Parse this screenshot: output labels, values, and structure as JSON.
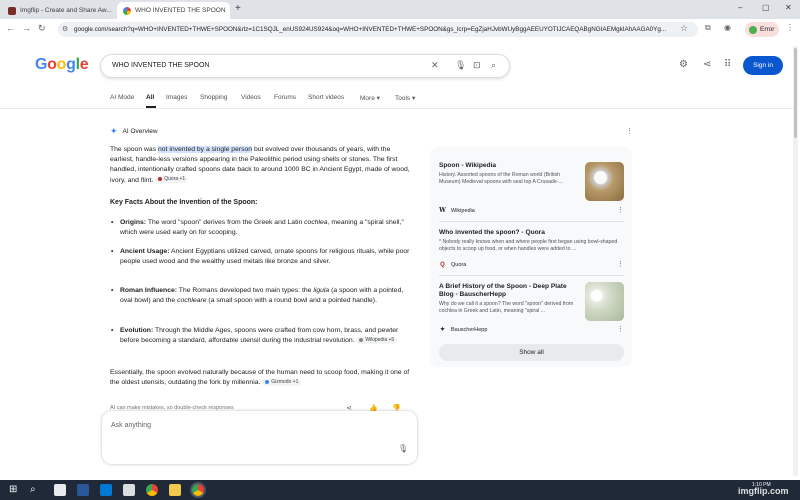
{
  "browser": {
    "tabs": [
      {
        "title": "Imgflip - Create and Share Aw...",
        "active": false
      },
      {
        "title": "WHO INVENTED THE SPOON",
        "active": true
      }
    ],
    "new_tab": "+",
    "url": "google.com/search?q=WHO+INVENTED+THWE+SPOON&rlz=1C1SQJL_enUS924US924&oq=WHO+INVENTED+THWE+SPOON&gs_lcrp=EgZjaHJvbWUyBggAEEUYOTIJCAEQABgNGIAEMgkIAhAAGA0Yg...",
    "error_button": "Error",
    "window_controls": [
      "–",
      "▢",
      "✕"
    ]
  },
  "google": {
    "logo_letters": [
      {
        "ch": "G",
        "color": "#4285f4"
      },
      {
        "ch": "o",
        "color": "#ea4335"
      },
      {
        "ch": "o",
        "color": "#fbbc05"
      },
      {
        "ch": "g",
        "color": "#4285f4"
      },
      {
        "ch": "l",
        "color": "#34a853"
      },
      {
        "ch": "e",
        "color": "#ea4335"
      }
    ],
    "query": "WHO INVENTED THE SPOON",
    "sign_in": "Sign in",
    "tabs": [
      "AI Mode",
      "All",
      "Images",
      "Shopping",
      "Videos",
      "Forums",
      "Short videos",
      "More ▾",
      "Tools ▾"
    ],
    "selected_tab": "All"
  },
  "ai_overview": {
    "heading": "AI Overview",
    "intro_pre": "The spoon was ",
    "intro_highlight": "not invented by a single person",
    "intro_post": " but evolved over thousands of years, with the earliest, handle-less versions appearing in the Paleolithic period using shells or stones. The first handled, intentionally crafted spoons date back to around 1000 BC in Ancient Egypt, made of wood, ivory, and flint.",
    "intro_chip": "Quora +1",
    "facts_heading": "Key Facts About the Invention of the Spoon:",
    "facts": [
      {
        "label": "Origins:",
        "text": " The word \"spoon\" derives from the Greek and Latin ",
        "em": "cochlea",
        "text2": ", meaning a \"spiral shell,\" which were used early on for scooping."
      },
      {
        "label": "Ancient Usage:",
        "text": " Ancient Egyptians utilized carved, ornate spoons for religious rituals, while poor people used wood and the wealthy used metals like bronze and silver.",
        "em": "",
        "text2": ""
      },
      {
        "label": "Roman Influence:",
        "text": " The Romans developed two main types: the ",
        "em": "ligula",
        "text2": " (a spoon with a pointed, oval bowl) and the ",
        "em2": "cochleare",
        "text3": " (a small spoon with a round bowl and a pointed handle)."
      },
      {
        "label": "Evolution:",
        "text": " Through the Middle Ages, spoons were crafted from cow horn, brass, and pewter before becoming a standard, affordable utensil during the industrial revolution.",
        "chip": "Wikipedia +5"
      }
    ],
    "conclusion": "Essentially, the spoon evolved naturally because of the human need to scoop food, making it one of the oldest utensils, outdating the fork by millennia.",
    "conclusion_chip": "Gizmodo +1",
    "disclaimer": "AI can make mistakes, so double-check responses"
  },
  "sources": [
    {
      "title": "Spoon - Wikipedia",
      "desc": "History. Assorted spoons of the Roman world (British Museum) Medieval spoons with seal top A Crusade-...",
      "site": "Wikipedia",
      "site_icon": "W",
      "icon_color": "#202124"
    },
    {
      "title": "Who invented the spoon? - Quora",
      "desc": "* Nobody really knows when and where people first began using bowl-shaped objects to scoop up food, or when handles were added to ...",
      "site": "Quora",
      "site_icon": "Q",
      "icon_color": "#b92b27"
    },
    {
      "title": "A Brief History of the Spoon - Deep Plate Blog - BauscherHepp",
      "desc": "Why do we call it a spoon? The word \"spoon\" derived from cochlea in Greek and Latin, meaning \"spiral ...",
      "site": "BauscherHepp",
      "site_icon": "✦",
      "icon_color": "#202124"
    }
  ],
  "show_all": "Show all",
  "ask": {
    "placeholder": "Ask anything"
  },
  "taskbar": {
    "clock_time": "1:10 PM",
    "clock_date": "",
    "watermark": "imgflip.com"
  }
}
